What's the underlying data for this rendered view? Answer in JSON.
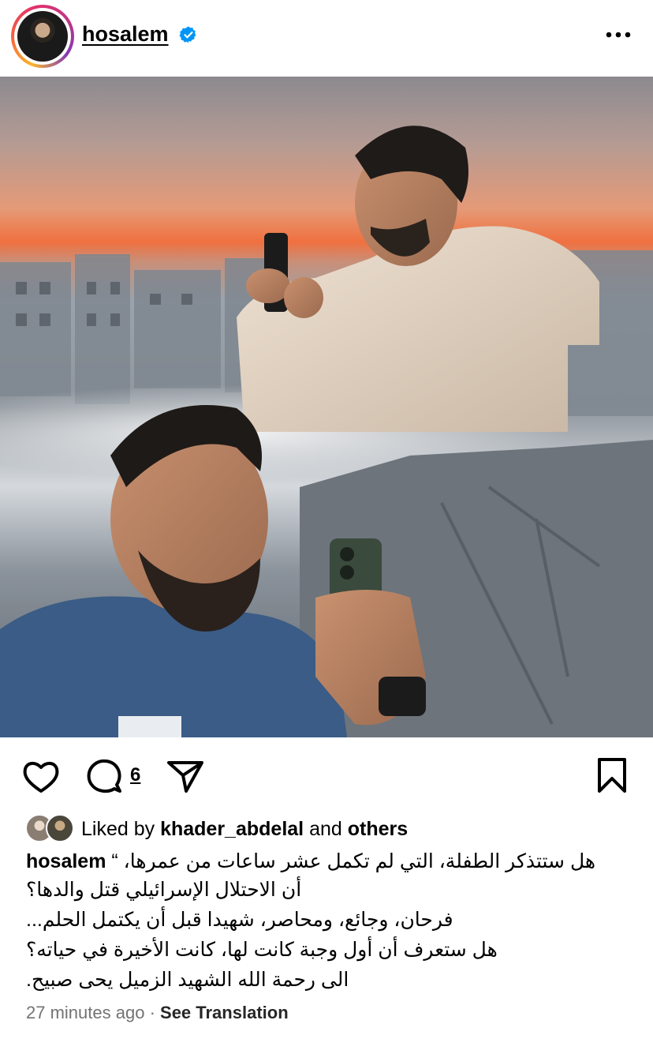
{
  "post": {
    "username": "hosalem",
    "verified": true,
    "comment_count": "6",
    "liked_by_prefix": "Liked by",
    "liked_by_user": "khader_abdelal",
    "liked_by_and": "and",
    "liked_by_others": "others",
    "caption_user": "hosalem",
    "caption_lines": [
      "هل ستتذكر الطفلة، التي لم تكمل عشر ساعات من عمرها، “",
      "أن الاحتلال الإسرائيلي قتل والدها؟",
      "فرحان، وجائع، ومحاصر، شهيدا قبل أن يكتمل الحلم...",
      "هل ستعرف أن أول وجبة كانت لها، كانت الأخيرة في حياته؟",
      "الى رحمة الله الشهيد الزميل يحى صبيح."
    ],
    "timestamp": "27 minutes ago",
    "separator": "·",
    "see_translation": "See Translation"
  },
  "icons": {
    "verified": "verified-badge-icon",
    "more": "more-options-icon",
    "like": "heart-icon",
    "comment": "comment-icon",
    "share": "send-icon",
    "save": "bookmark-icon"
  },
  "colors": {
    "verified_blue": "#0095f6",
    "muted_text": "#737373"
  }
}
